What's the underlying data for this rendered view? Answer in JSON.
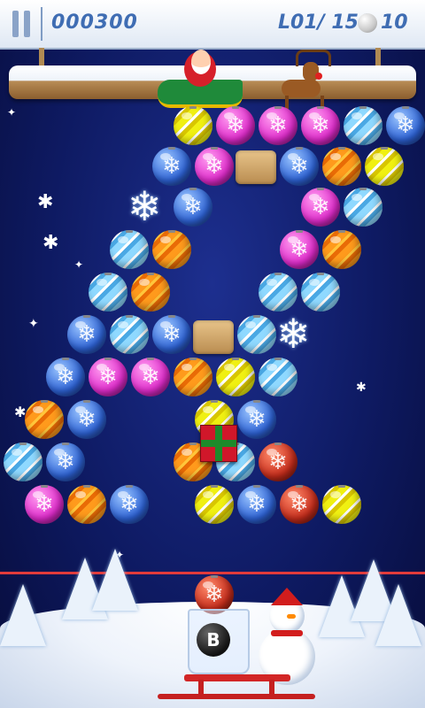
{
  "hud": {
    "score": "000300",
    "level": "L01/ 150",
    "shots_remaining": "10",
    "pause_icon": "pause-icon",
    "ball_icon": "snowball-icon"
  },
  "launcher": {
    "current_ball": "red",
    "bomb_label": "B"
  },
  "colors": {
    "background": "#0e1a62",
    "danger_line": "#e23b3b",
    "hud_text": "#3f6db3"
  }
}
